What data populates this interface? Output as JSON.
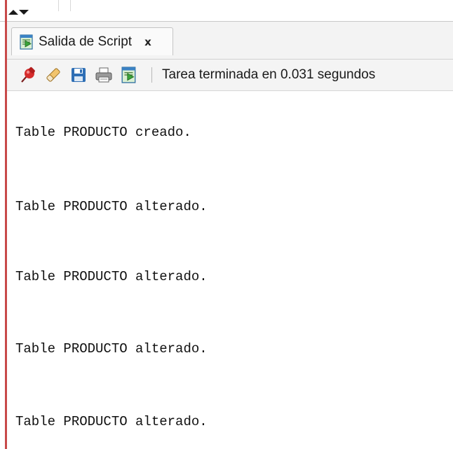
{
  "tab": {
    "label": "Salida de Script",
    "close_label": "x",
    "icon": "script-output-icon"
  },
  "toolbar": {
    "buttons": [
      {
        "name": "pin-icon",
        "title": "pin"
      },
      {
        "name": "eraser-icon",
        "title": "clear"
      },
      {
        "name": "save-icon",
        "title": "save"
      },
      {
        "name": "print-icon",
        "title": "print"
      },
      {
        "name": "script-output-icon",
        "title": "output"
      }
    ],
    "status": "Tarea terminada en 0.031 segundos"
  },
  "output": {
    "lines": [
      "Table PRODUCTO creado.",
      "Table PRODUCTO alterado.",
      "Table PRODUCTO alterado.",
      "Table PRODUCTO alterado.",
      "Table PRODUCTO alterado."
    ]
  },
  "colors": {
    "left_marker": "#c84a4a",
    "toolbar_bg": "#f4f4f4",
    "text": "#111111"
  }
}
